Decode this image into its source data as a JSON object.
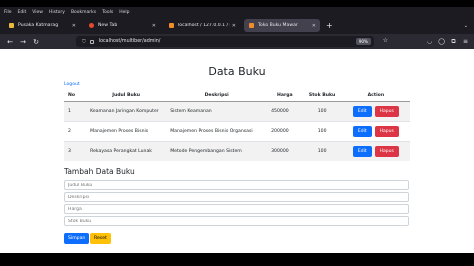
{
  "browser": {
    "menu": [
      "File",
      "Edit",
      "View",
      "History",
      "Bookmarks",
      "Tools",
      "Help"
    ],
    "tabs": [
      {
        "title": "Pusaka Katmarag",
        "favicon_color": "#e8b93b",
        "active": false
      },
      {
        "title": "New Tab",
        "favicon_color": "#e64a2e",
        "active": false
      },
      {
        "title": "localhost / 127.0.0.1 / multiber",
        "favicon_color": "#f28c2a",
        "active": false
      },
      {
        "title": "Toko Buku Mawar",
        "favicon_color": "#f28c2a",
        "active": true
      }
    ],
    "new_tab_label": "+",
    "url": "localhost/multiber/admin/",
    "zoom": "90%"
  },
  "page": {
    "title": "Data Buku",
    "logout_label": "Logout",
    "table": {
      "headers": [
        "No",
        "Judul Buku",
        "Deskripsi",
        "Harga",
        "Stok Buku",
        "Action"
      ],
      "rows": [
        {
          "no": "1",
          "judul": "Keamanan Jaringan Komputer",
          "deskripsi": "Sistem Keamanan",
          "harga": "450000",
          "stok": "100"
        },
        {
          "no": "2",
          "judul": "Manajemen Proses Bisnis",
          "deskripsi": "Manajemen Proses Bisnis Organsasi",
          "harga": "200000",
          "stok": "100"
        },
        {
          "no": "3",
          "judul": "Rekayasa Perangkat Lunak",
          "deskripsi": "Metode Pengembangan Sistem",
          "harga": "300000",
          "stok": "100"
        }
      ],
      "edit_label": "Edit",
      "delete_label": "Hapus"
    },
    "form": {
      "title": "Tambah Data Buku",
      "fields": [
        {
          "placeholder": "Judul Buku"
        },
        {
          "placeholder": "Deskripsi"
        },
        {
          "placeholder": "Harga"
        },
        {
          "placeholder": "Stok Buku"
        }
      ],
      "submit_label": "Simpan",
      "reset_label": "Reset"
    }
  },
  "colors": {
    "primary": "#0d6efd",
    "danger": "#dc3545",
    "warning": "#ffc107",
    "chrome_dark": "#1c1b22"
  }
}
